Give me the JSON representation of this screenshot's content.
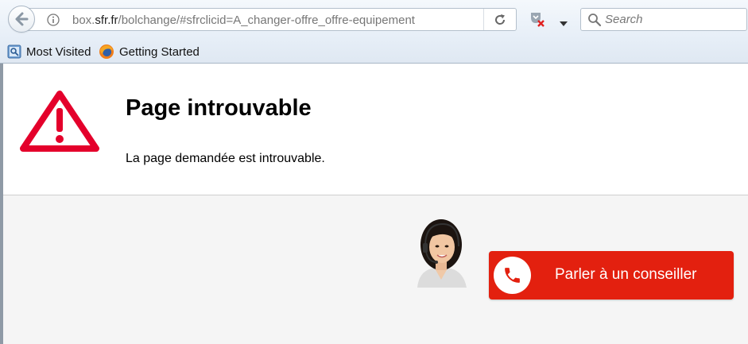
{
  "browser": {
    "url_prefix": "box.",
    "url_domain": "sfr.fr",
    "url_path": "/bolchange/#sfrclicid=A_changer-offre_offre-equipement",
    "search_placeholder": "Search",
    "bookmarks": [
      {
        "label": "Most Visited",
        "icon": "most-visited-icon"
      },
      {
        "label": "Getting Started",
        "icon": "firefox-icon"
      }
    ]
  },
  "error": {
    "icon": "warning-icon",
    "title": "Page introuvable",
    "message": "La page demandée est introuvable."
  },
  "help": {
    "agent_image": "customer-service-agent-photo",
    "button_label": "Parler à un conseiller",
    "button_icon": "phone-icon"
  },
  "colors": {
    "accent_red": "#e3200f",
    "warning_red": "#e4002b"
  }
}
